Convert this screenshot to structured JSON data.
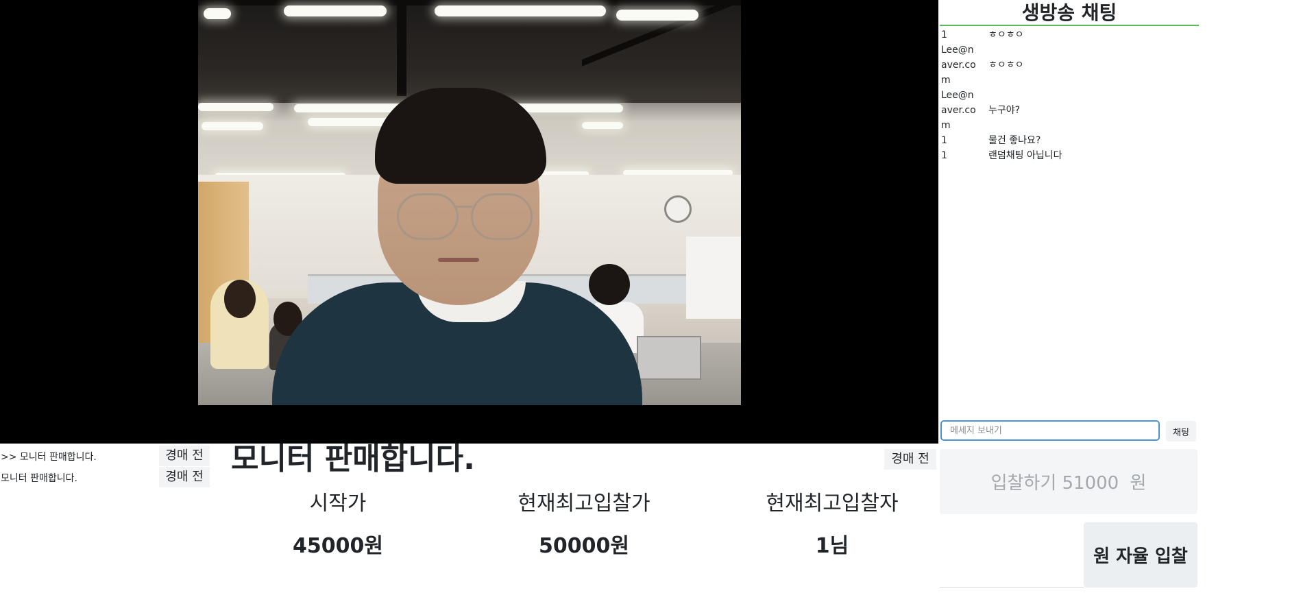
{
  "chat": {
    "title": "생방송 채팅",
    "messages": [
      {
        "user": "1",
        "text": "ㅎㅇㅎㅇ"
      },
      {
        "user": "Lee@naver.com",
        "text": "ㅎㅇㅎㅇ"
      },
      {
        "user": "Lee@naver.com",
        "text": "누구야?"
      },
      {
        "user": "1",
        "text": "물건 좋나요?"
      },
      {
        "user": "1",
        "text": "랜덤채팅 아닙니다"
      }
    ],
    "input_placeholder": "메세지 보내기",
    "send_label": "채팅"
  },
  "bid": {
    "label": "입찰하기",
    "amount": "51000",
    "unit": "원"
  },
  "auto_bid": {
    "label": "원 자율 입찰"
  },
  "auctions": [
    {
      "title": ">> 모니터 판매합니다.",
      "status": "경매 전"
    },
    {
      "title": "모니터 판매합니다.",
      "status": "경매 전"
    }
  ],
  "product": {
    "title": "모니터 판매합니다.",
    "status": "경매 전",
    "start_price_label": "시작가",
    "start_price": "45000원",
    "current_price_label": "현재최고입찰가",
    "current_price": "50000원",
    "top_bidder_label": "현재최고입찰자",
    "top_bidder": "1님"
  },
  "colors": {
    "chat_divider": "#5cb85c",
    "input_focus_border": "#4d90d6",
    "video_background": "#000000"
  }
}
